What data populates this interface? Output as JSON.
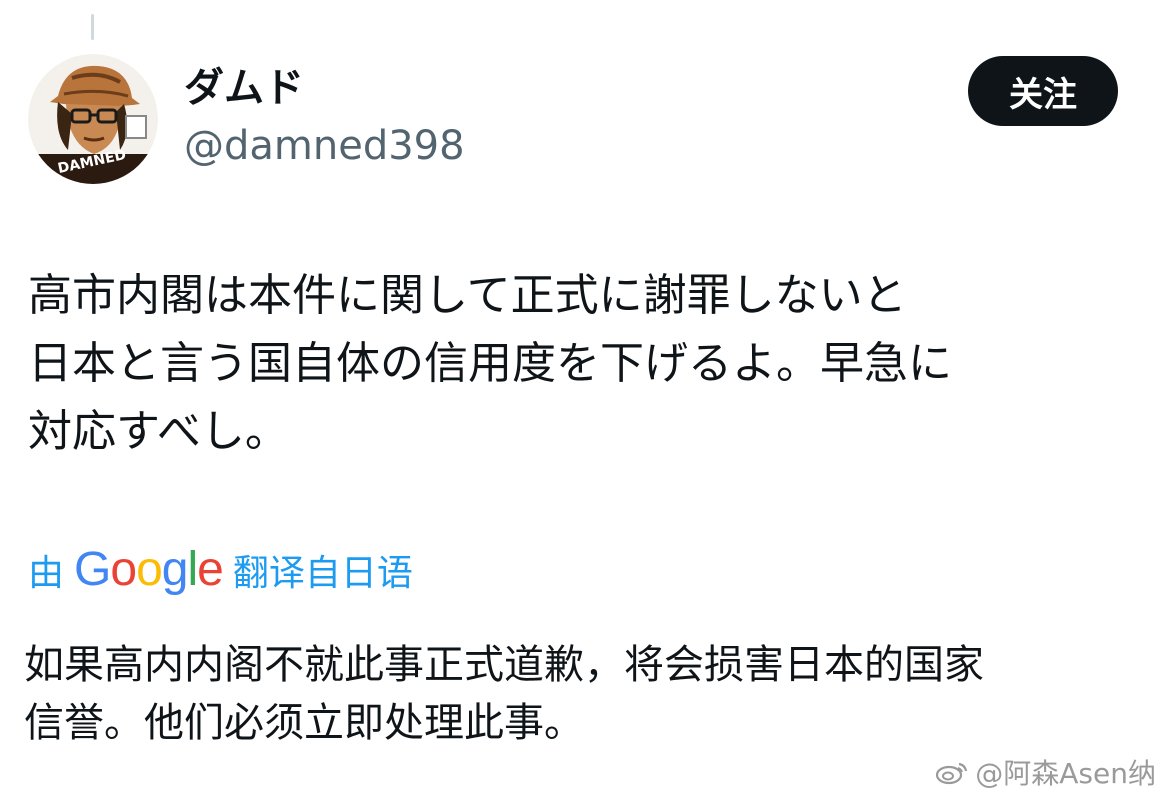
{
  "user": {
    "display_name": "ダムド",
    "handle": "@damned398",
    "avatar_caption": "DAMNED"
  },
  "follow_button": {
    "label": "关注"
  },
  "tweet": {
    "lines": [
      "高市内閣は本件に関して正式に謝罪しないと",
      "日本と言う国自体の信用度を下げるよ。早急に",
      "対応すべし。"
    ]
  },
  "translation": {
    "prefix": "由",
    "google_letters": [
      "G",
      "o",
      "o",
      "g",
      "l",
      "e"
    ],
    "google_colors": [
      "#4285F4",
      "#EA4335",
      "#FBBC05",
      "#4285F4",
      "#34A853",
      "#EA4335"
    ],
    "suffix": "翻译自日语",
    "lines": [
      "如果高内内阁不就此事正式道歉，将会损害日本的国家",
      "信誉。他们必须立即处理此事。"
    ]
  },
  "watermark": {
    "text": "@阿森Asen纳"
  },
  "colors": {
    "link_blue": "#1d9bf0",
    "button_bg": "#0f1419",
    "handle_gray": "#536471"
  }
}
